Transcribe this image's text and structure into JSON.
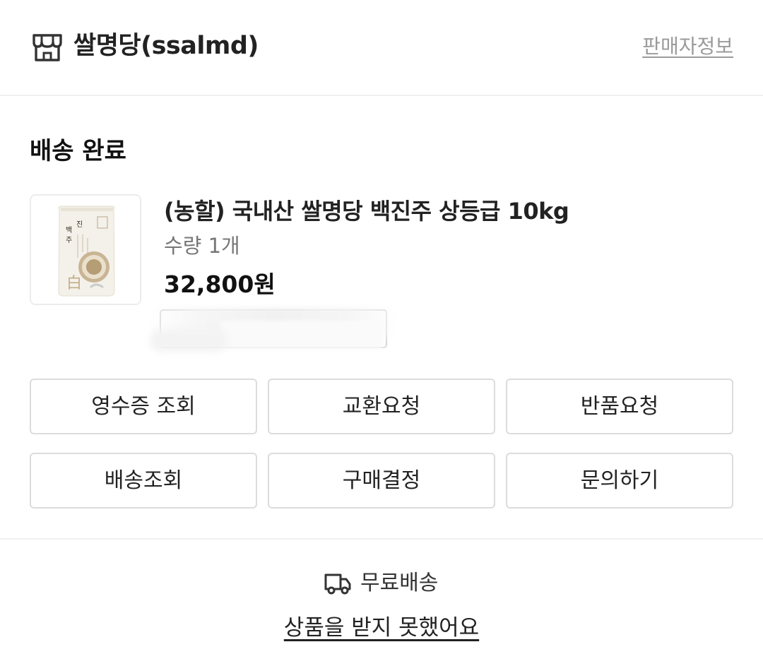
{
  "header": {
    "store_name": "쌀명당(ssalmd)",
    "seller_info_label": "판매자정보",
    "store_icon": "store-icon"
  },
  "order": {
    "status": "배송 완료",
    "product": {
      "name": "(농할) 국내산 쌀명당 백진주 상등급 10kg",
      "quantity": "수량 1개",
      "price": "32,800원",
      "thumbnail_text": "백진주",
      "thumbnail_glyph": "白"
    }
  },
  "actions": [
    {
      "label": "영수증 조회"
    },
    {
      "label": "교환요청"
    },
    {
      "label": "반품요청"
    },
    {
      "label": "배송조회"
    },
    {
      "label": "구매결정"
    },
    {
      "label": "문의하기"
    }
  ],
  "shipping": {
    "label": "무료배송",
    "icon": "truck-icon"
  },
  "footer": {
    "not_received_link": "상품을 받지 못했어요"
  }
}
